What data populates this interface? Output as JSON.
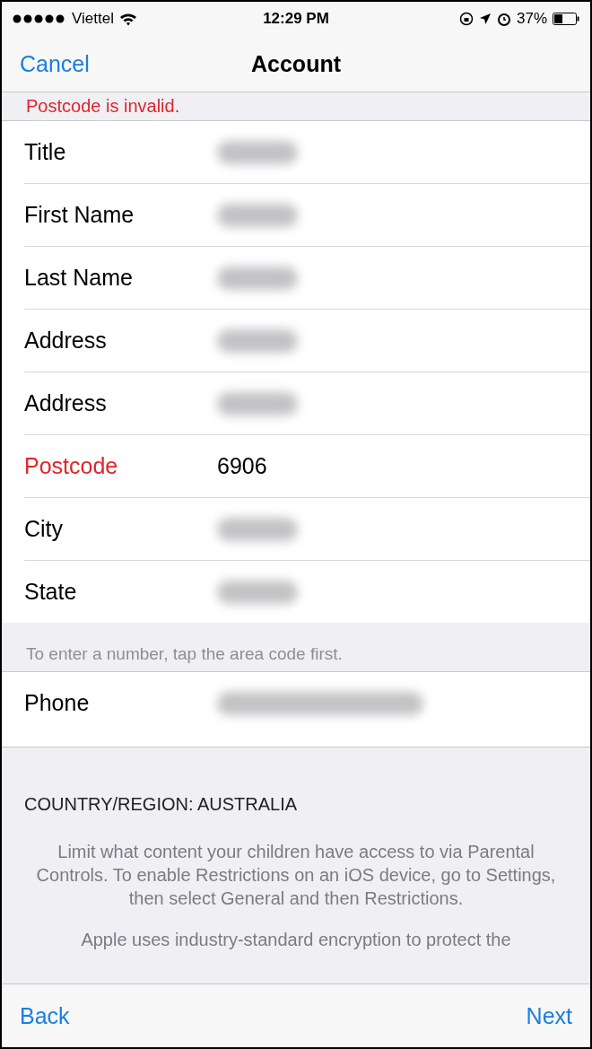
{
  "status_bar": {
    "carrier": "Viettel",
    "time": "12:29 PM",
    "battery": "37%"
  },
  "nav": {
    "left": "Cancel",
    "title": "Account"
  },
  "error": "Postcode is invalid.",
  "fields": [
    {
      "label": "Title",
      "redacted": true,
      "invalid": false
    },
    {
      "label": "First Name",
      "redacted": true,
      "invalid": false
    },
    {
      "label": "Last Name",
      "redacted": true,
      "invalid": false
    },
    {
      "label": "Address",
      "redacted": true,
      "invalid": false
    },
    {
      "label": "Address",
      "redacted": true,
      "invalid": false
    },
    {
      "label": "Postcode",
      "value": "6906",
      "redacted": false,
      "invalid": true
    },
    {
      "label": "City",
      "redacted": true,
      "invalid": false
    },
    {
      "label": "State",
      "redacted": true,
      "invalid": false
    }
  ],
  "phone_hint": "To enter a number, tap the area code first.",
  "phone": {
    "label": "Phone",
    "redacted": true,
    "invalid": false
  },
  "country": "COUNTRY/REGION: AUSTRALIA",
  "notes": [
    "Limit what content your children have access to via Parental Controls. To enable Restrictions on an iOS device, go to Settings, then select General and then Restrictions.",
    "Apple uses industry-standard encryption to protect the"
  ],
  "toolbar": {
    "left": "Back",
    "right": "Next"
  }
}
